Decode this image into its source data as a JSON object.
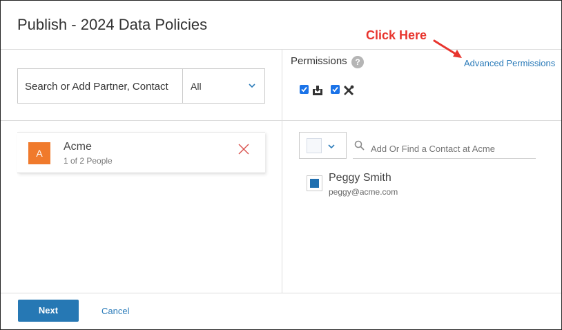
{
  "dialog": {
    "title": "Publish - 2024 Data Policies"
  },
  "search": {
    "placeholder": "Search or Add Partner, Contact",
    "filter_value": "All"
  },
  "permissions": {
    "label": "Permissions",
    "help_icon": "?",
    "advanced_link": "Advanced Permissions",
    "callout": "Click Here",
    "items": [
      {
        "checked": true,
        "icon": "download-tray-icon"
      },
      {
        "checked": true,
        "icon": "tools-icon"
      }
    ]
  },
  "partners": [
    {
      "initial": "A",
      "name": "Acme",
      "count": "1 of 2 People"
    }
  ],
  "contacts": {
    "find_placeholder": "Add Or Find a Contact at Acme",
    "items": [
      {
        "name": "Peggy Smith",
        "email": "peggy@acme.com",
        "selected": true
      }
    ]
  },
  "footer": {
    "next_label": "Next",
    "cancel_label": "Cancel"
  },
  "colors": {
    "accent": "#2678b4",
    "link": "#2b7bb9",
    "avatar": "#f07a2c",
    "callout": "#e8352e",
    "remove": "#d9534f"
  }
}
